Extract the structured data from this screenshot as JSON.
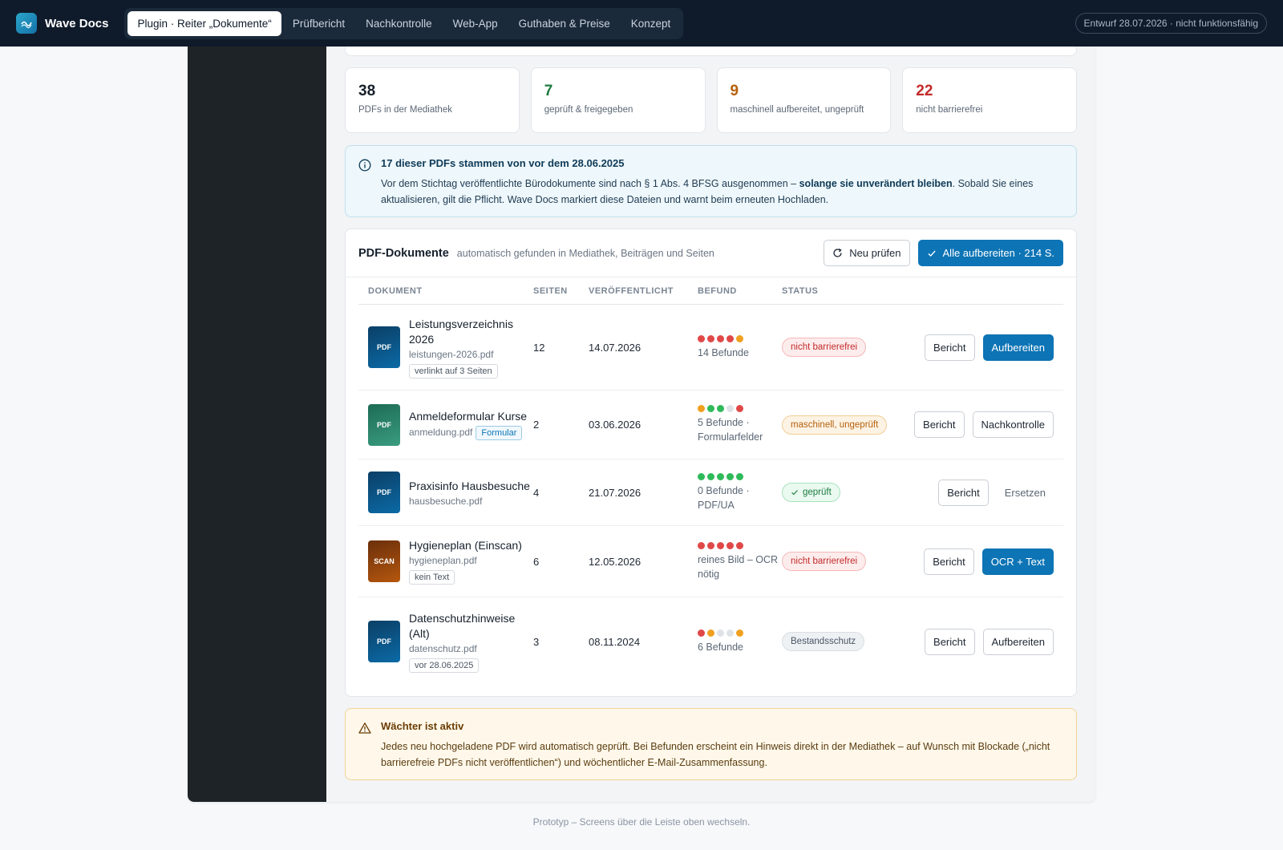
{
  "brand": {
    "name": "Wave Docs"
  },
  "nav": {
    "tabs": [
      {
        "label": "Plugin · Reiter „Dokumente“"
      },
      {
        "label": "Prüfbericht"
      },
      {
        "label": "Nachkontrolle"
      },
      {
        "label": "Web-App"
      },
      {
        "label": "Guthaben & Preise"
      },
      {
        "label": "Konzept"
      }
    ],
    "draft": "Entwurf 28.07.2026 · nicht funktionsfähig"
  },
  "stats": [
    {
      "value": "38",
      "label": "PDFs in der Mediathek",
      "color": "#16202c"
    },
    {
      "value": "7",
      "label": "geprüft & freigegeben",
      "color": "#1c7c40"
    },
    {
      "value": "9",
      "label": "maschinell aufbereitet, ungeprüft",
      "color": "#b5610c"
    },
    {
      "value": "22",
      "label": "nicht barrierefrei",
      "color": "#c42b2b"
    }
  ],
  "info": {
    "title": "17 dieser PDFs stammen von vor dem 28.06.2025",
    "text_a": "Vor dem Stichtag veröffentlichte Bürodokumente sind nach § 1 Abs. 4 BFSG ausgenommen – ",
    "text_bold": "solange sie unverändert bleiben",
    "text_b": ". Sobald Sie eines aktualisieren, gilt die Pflicht. Wave Docs markiert diese Dateien und warnt beim erneuten Hochladen."
  },
  "docs": {
    "title": "PDF-Dokumente",
    "subtitle": "automatisch gefunden in Mediathek, Beiträgen und Seiten",
    "recheck_label": "Neu prüfen",
    "process_all_label": "Alle aufbereiten · 214 S.",
    "columns": {
      "doc": "DOKUMENT",
      "pages": "SEITEN",
      "date": "VERÖFFENTLICHT",
      "findings": "BEFUND",
      "status": "STATUS"
    },
    "rows": [
      {
        "icon": "PDF",
        "name": "Leistungsverzeichnis 2026",
        "file": "leistungen-2026.pdf",
        "tag": "verlinkt auf 3 Seiten",
        "pages": "12",
        "date": "14.07.2026",
        "findings": "14 Befunde",
        "status": "nicht barrierefrei",
        "action1": "Bericht",
        "action2": "Aufbereiten"
      },
      {
        "icon": "PDF",
        "name": "Anmeldeformular Kurse",
        "file": "anmeldung.pdf",
        "tag": "Formular",
        "pages": "2",
        "date": "03.06.2026",
        "findings": "5 Befunde · Formularfelder",
        "status": "maschinell, ungeprüft",
        "action1": "Bericht",
        "action2": "Nachkontrolle"
      },
      {
        "icon": "PDF",
        "name": "Praxisinfo Hausbesuche",
        "file": "hausbesuche.pdf",
        "tag": "",
        "pages": "4",
        "date": "21.07.2026",
        "findings": "0 Befunde · PDF/UA",
        "status": "geprüft",
        "action1": "Bericht",
        "action2": "Ersetzen"
      },
      {
        "icon": "SCAN",
        "name": "Hygieneplan (Einscan)",
        "file": "hygieneplan.pdf",
        "tag": "kein Text",
        "pages": "6",
        "date": "12.05.2026",
        "findings": "reines Bild – OCR nötig",
        "status": "nicht barrierefrei",
        "action1": "Bericht",
        "action2": "OCR + Text"
      },
      {
        "icon": "PDF",
        "name": "Datenschutzhinweise (Alt)",
        "file": "datenschutz.pdf",
        "tag": "vor 28.06.2025",
        "pages": "3",
        "date": "08.11.2024",
        "findings": "6 Befunde",
        "status": "Bestandsschutz",
        "action1": "Bericht",
        "action2": "Aufbereiten"
      }
    ]
  },
  "warn": {
    "title": "Wächter ist aktiv",
    "text": "Jedes neu hochgeladene PDF wird automatisch geprüft. Bei Befunden erscheint ein Hinweis direkt in der Mediathek – auf Wunsch mit Blockade („nicht barrierefreie PDFs nicht veröffentlichen“) und wöchentlicher E-Mail-Zusammenfassung."
  },
  "footer": "Prototyp – Screens über die Leiste oben wechseln."
}
